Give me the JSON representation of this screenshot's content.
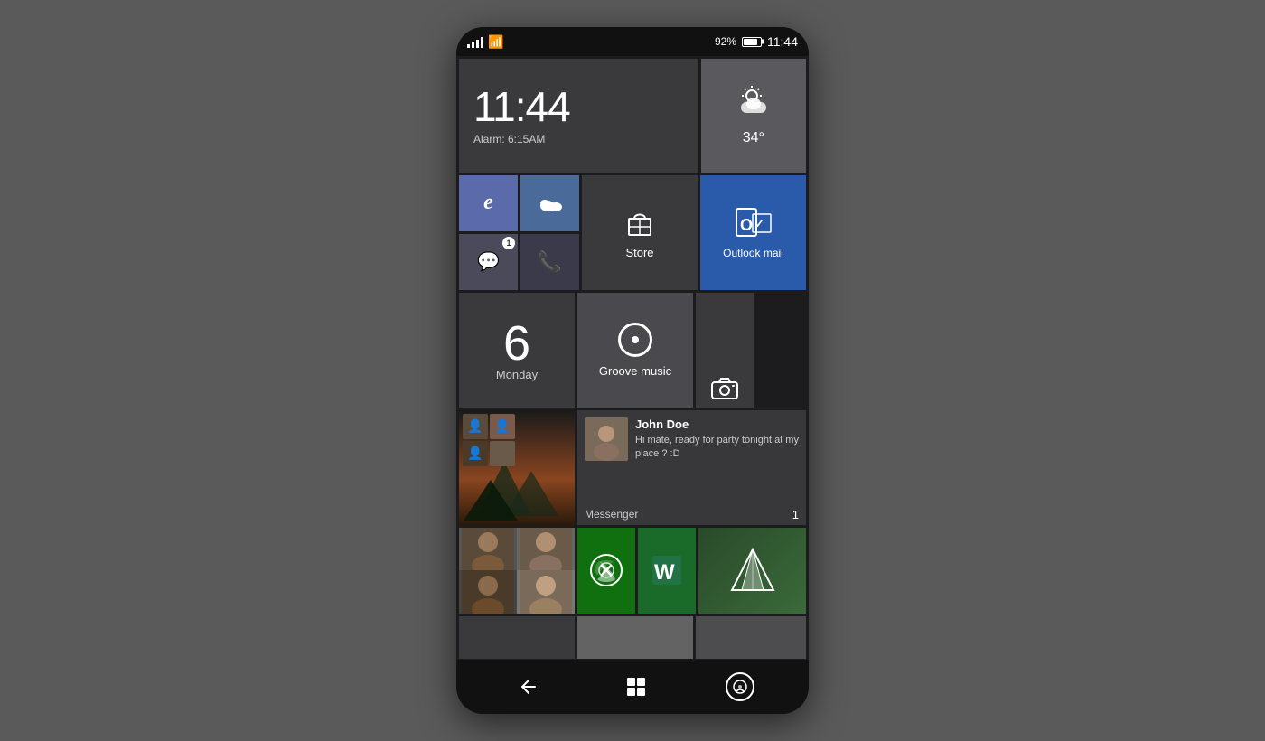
{
  "phone": {
    "status_bar": {
      "battery_pct": "92%",
      "time": "11:44"
    },
    "tiles": {
      "clock": {
        "time": "11:44",
        "alarm": "Alarm: 6:15AM"
      },
      "weather": {
        "temp": "34°"
      },
      "store": {
        "label": "Store"
      },
      "outlook": {
        "label": "Outlook mail"
      },
      "calendar": {
        "number": "6",
        "day": "Monday"
      },
      "groove": {
        "label": "Groove music"
      },
      "messenger": {
        "sender": "John Doe",
        "message": "Hi mate, ready for party tonight at my place ? :D",
        "app_label": "Messenger",
        "count": "1"
      }
    },
    "nav": {
      "back": "←",
      "cortana_label": "cortana"
    }
  }
}
